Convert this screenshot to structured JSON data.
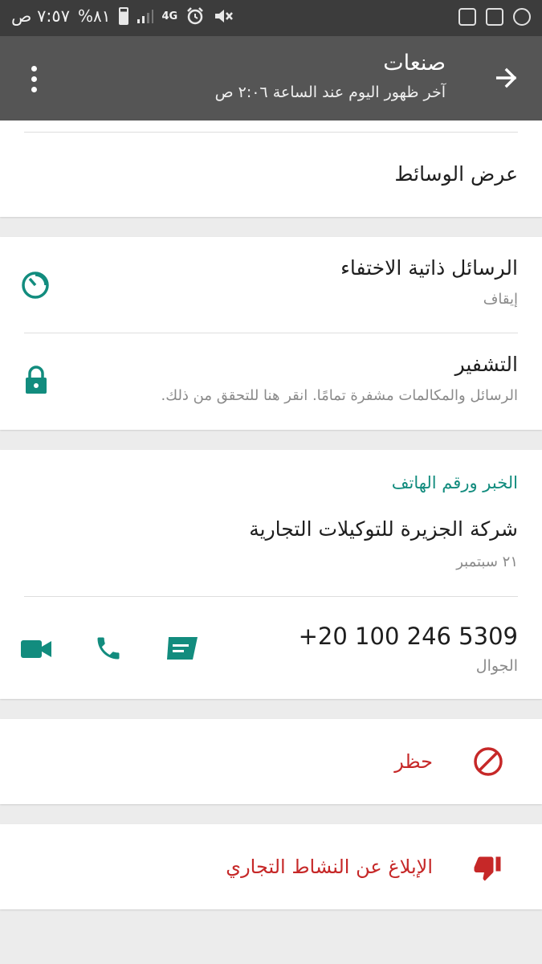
{
  "status_bar": {
    "time": "٧:٥٧ ص",
    "battery": "%٨١",
    "network": "4G"
  },
  "app_bar": {
    "contact_name": "صنعات",
    "last_seen": "آخر ظهور اليوم عند الساعة ٢:٠٦ ص"
  },
  "media": {
    "label": "عرض الوسائط"
  },
  "disappearing": {
    "title": "الرسائل ذاتية الاختفاء",
    "value": "إيقاف"
  },
  "encryption": {
    "title": "التشفير",
    "description": "الرسائل والمكالمات مشفرة تمامًا. انقر هنا للتحقق من ذلك."
  },
  "about": {
    "header": "الخبر ورقم الهاتف",
    "status": "شركة الجزيرة للتوكيلات التجارية",
    "date": "٢١ سبتمبر"
  },
  "phone": {
    "number": "+20 100 246 5309",
    "type": "الجوال"
  },
  "block": {
    "label": "حظر"
  },
  "report": {
    "label": "الإبلاغ عن النشاط التجاري"
  },
  "colors": {
    "teal": "#128C7E",
    "danger": "#C62828",
    "appbar": "#555555",
    "statusbar": "#3c3c3c"
  }
}
